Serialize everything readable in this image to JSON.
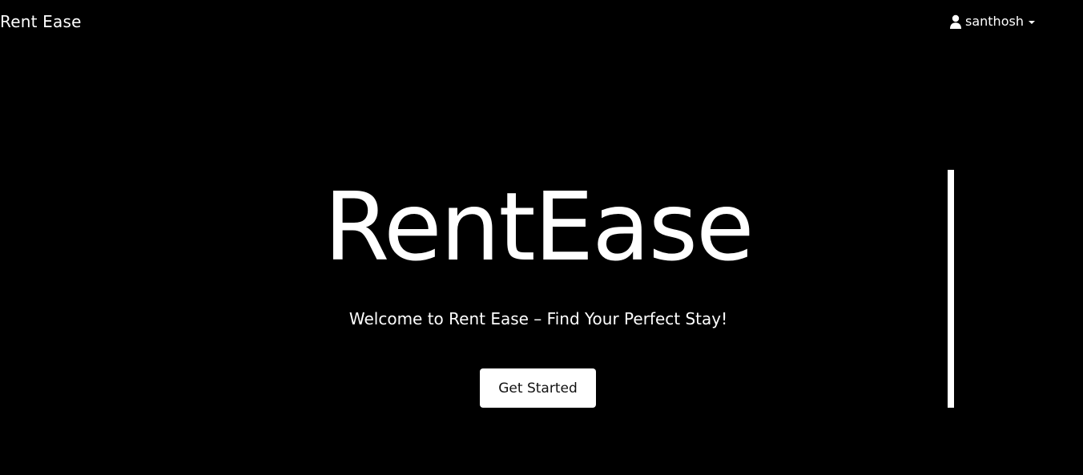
{
  "navbar": {
    "brand": "Rent Ease",
    "user": {
      "icon": "user-icon",
      "name": "santhosh",
      "dropdown_icon": "caret-down-icon"
    }
  },
  "hero": {
    "title": "RentEase",
    "subtitle": "Welcome to Rent Ease – Find Your Perfect Stay!",
    "cta_label": "Get Started"
  },
  "colors": {
    "background": "#000000",
    "text": "#ffffff",
    "button_bg": "#ffffff",
    "button_text": "#111111"
  }
}
